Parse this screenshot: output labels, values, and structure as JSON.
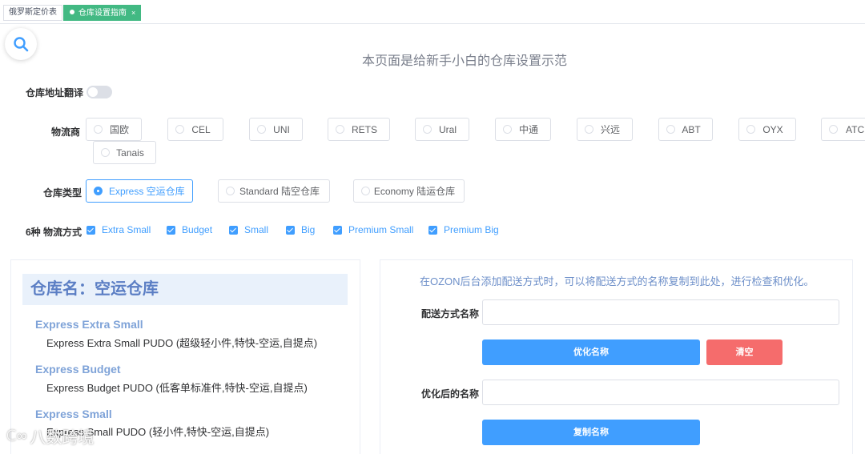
{
  "tabs": [
    {
      "label": "俄罗斯定价表",
      "active": false
    },
    {
      "label": "仓库设置指南",
      "active": true
    }
  ],
  "tab_close_glyph": "×",
  "page_title": "本页面是给新手小白的仓库设置示范",
  "address_translate": {
    "label": "仓库地址翻译",
    "on": false
  },
  "carriers": {
    "label": "物流商",
    "options": [
      "国欧",
      "CEL",
      "UNI",
      "RETS",
      "Ural",
      "中通",
      "兴远",
      "ABT",
      "OYX",
      "ATC",
      "Tanais"
    ]
  },
  "warehouse_type": {
    "label": "仓库类型",
    "options": [
      "Express 空运仓库",
      "Standard 陆空仓库",
      "Economy 陆运仓库"
    ],
    "selected": "Express 空运仓库"
  },
  "methods": {
    "label": "6种 物流方式",
    "options": [
      "Extra Small",
      "Budget",
      "Small",
      "Big",
      "Premium Small",
      "Premium Big"
    ]
  },
  "warehouse_panel": {
    "title": "仓库名：空运仓库",
    "items": [
      {
        "name": "Express Extra Small",
        "desc": "Express Extra Small PUDO (超级轻小件,特快-空运,自提点)"
      },
      {
        "name": "Express Budget",
        "desc": "Express Budget PUDO (低客单标准件,特快-空运,自提点)"
      },
      {
        "name": "Express Small",
        "desc": "Express Small PUDO (轻小件,特快-空运,自提点)"
      }
    ]
  },
  "optimizer": {
    "hint": "在OZON后台添加配送方式时，可以将配送方式的名称复制到此处，进行检查和优化。",
    "name_label": "配送方式名称",
    "name_value": "",
    "optimize_button": "优化名称",
    "clear_button": "清空",
    "result_label": "优化后的名称",
    "result_value": "",
    "copy_button": "复制名称"
  },
  "watermark": {
    "mark": "ℂ∞",
    "text": "八数跨境"
  },
  "colors": {
    "accent": "#409eff",
    "active_tab": "#42b983",
    "danger": "#f56c6c",
    "title_bg": "#e9f1fb"
  },
  "icons": {
    "search": "search-icon",
    "checkbox": "checkbox-checked-icon"
  }
}
